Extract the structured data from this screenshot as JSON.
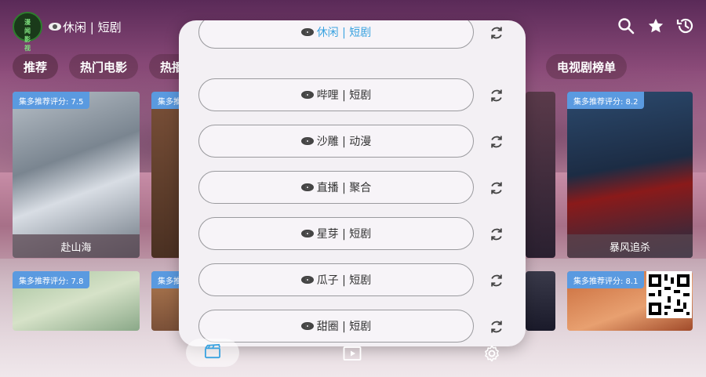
{
  "header": {
    "logo_chars": [
      "漫",
      "闻",
      "影",
      "视"
    ],
    "title": "休闲 | 短剧"
  },
  "tabs": [
    "推荐",
    "热门电影",
    "热播",
    "电视剧榜单"
  ],
  "posters": [
    {
      "badge": "集多推荐评分: 7.5",
      "caption": "赴山海"
    },
    {
      "badge": "集多推",
      "caption": ""
    },
    {
      "badge": "",
      "caption": ""
    },
    {
      "badge": "集多推荐评分: 8.2",
      "caption": "暴风追杀"
    },
    {
      "badge": "集多推荐评分: 7.8",
      "caption": ""
    },
    {
      "badge": "集多推",
      "caption": ""
    },
    {
      "badge": "",
      "caption": ""
    },
    {
      "badge": "集多推荐评分: 8.1",
      "caption": ""
    }
  ],
  "popup": {
    "sources": [
      {
        "label": "休闲 | 短剧",
        "active": true
      },
      {
        "label": "哔哩 | 短剧",
        "active": false
      },
      {
        "label": "沙雕 | 动漫",
        "active": false
      },
      {
        "label": "直播 | 聚合",
        "active": false
      },
      {
        "label": "星芽 | 短剧",
        "active": false
      },
      {
        "label": "瓜子 | 短剧",
        "active": false
      },
      {
        "label": "甜圈 | 短剧",
        "active": false
      }
    ]
  },
  "bottom_nav": {
    "items": [
      "movies-icon",
      "player-icon",
      "settings-icon"
    ]
  },
  "colors": {
    "accent": "#3ba3e0",
    "badge": "#5a9ae0"
  }
}
